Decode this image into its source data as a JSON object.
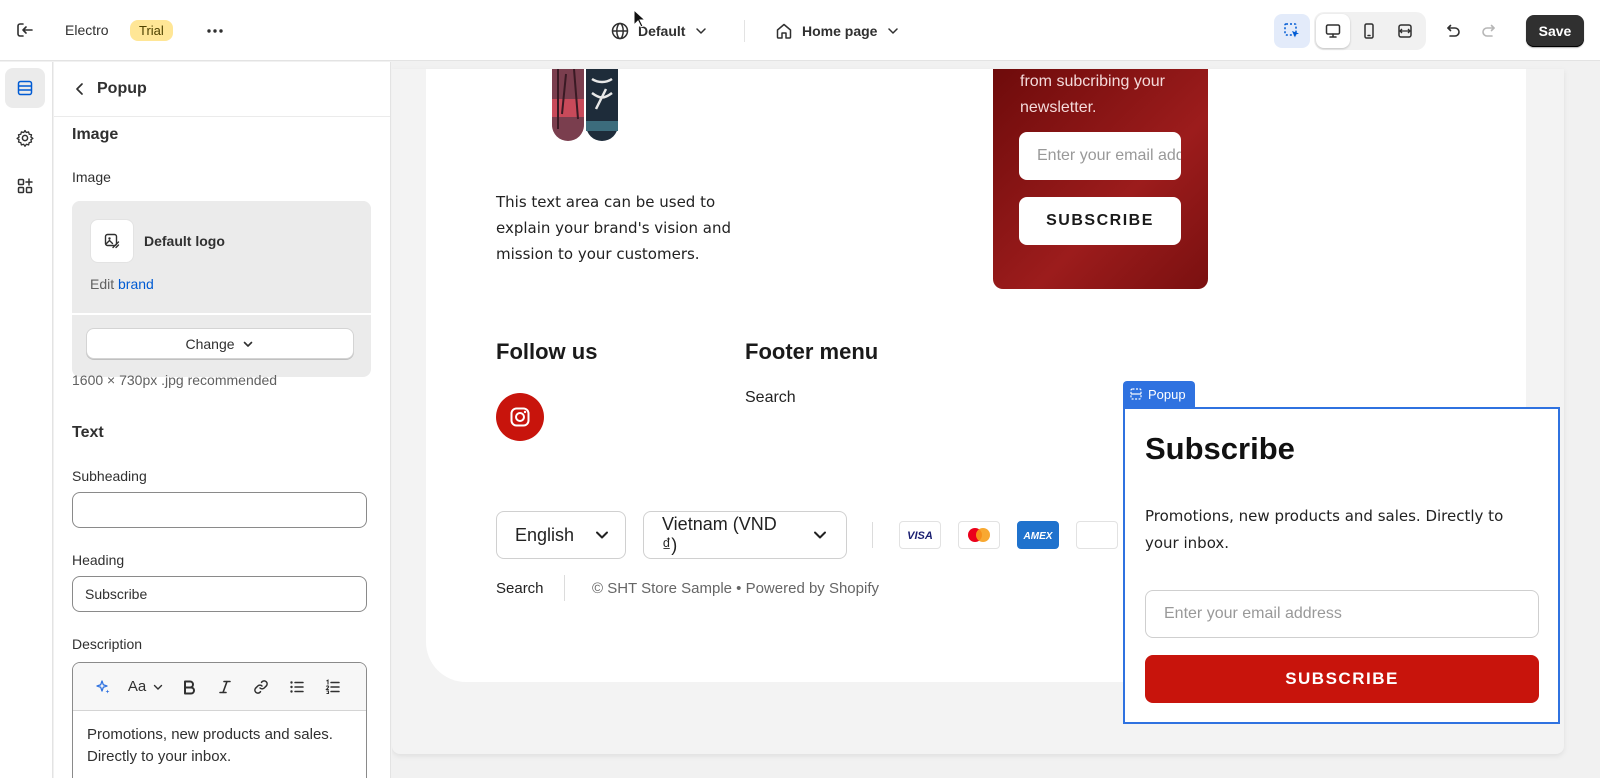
{
  "topbar": {
    "store_name": "Electro",
    "plan_badge": "Trial",
    "theme_label": "Default",
    "page_label": "Home page",
    "save_label": "Save"
  },
  "panel": {
    "title": "Popup",
    "image_section": "Image",
    "image_label": "Image",
    "logo_name": "Default logo",
    "edit_prefix": "Edit",
    "edit_link": "brand",
    "change_label": "Change",
    "image_hint": "1600 × 730px .jpg recommended",
    "text_section": "Text",
    "subheading_label": "Subheading",
    "subheading_value": "",
    "heading_label": "Heading",
    "heading_value": "Subscribe",
    "description_label": "Description",
    "description_value": "Promotions, new products and sales. Directly to your inbox.",
    "rte_font_label": "Aa"
  },
  "preview": {
    "brand_text": "This text area can be used to explain your brand's vision and mission to your customers.",
    "newsletter_text": "from subcribing your newsletter.",
    "newsletter_placeholder": "Enter your email address",
    "newsletter_button": "SUBSCRIBE",
    "follow_heading": "Follow us",
    "menu_heading": "Footer menu",
    "menu_link": "Search",
    "language": "English",
    "currency": "Vietnam (VND ₫)",
    "payments": [
      "VISA",
      "Mastercard",
      "AMEX"
    ],
    "footer_link": "Search",
    "copyright": "© SHT Store Sample • Powered by Shopify"
  },
  "popup": {
    "tag_label": "Popup",
    "heading": "Subscribe",
    "description": "Promotions, new products and sales. Directly to your inbox.",
    "placeholder": "Enter your email address",
    "button": "SUBSCRIBE"
  },
  "colors": {
    "accent": "#c8140c",
    "selection": "#2f72e0",
    "newsletter_bg": "#8b1515"
  }
}
